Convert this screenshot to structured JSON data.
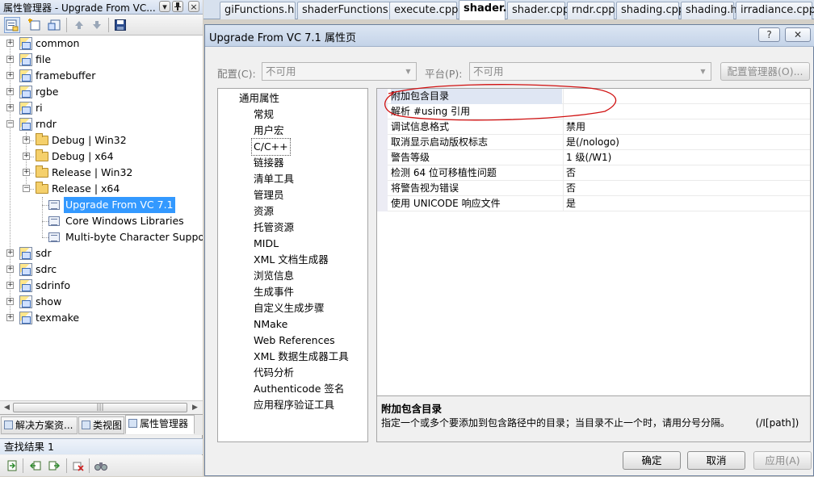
{
  "left_panel": {
    "title": "属性管理器 - Upgrade From VC...",
    "pin_icon": "pin-icon",
    "close_label": "×",
    "dropdown_label": "▾",
    "tree": [
      {
        "label": "common",
        "type": "project"
      },
      {
        "label": "file",
        "type": "project"
      },
      {
        "label": "framebuffer",
        "type": "project"
      },
      {
        "label": "rgbe",
        "type": "project"
      },
      {
        "label": "ri",
        "type": "project"
      },
      {
        "label": "rndr",
        "type": "project"
      },
      {
        "label": "Debug | Win32",
        "type": "folder"
      },
      {
        "label": "Debug | x64",
        "type": "folder"
      },
      {
        "label": "Release | Win32",
        "type": "folder"
      },
      {
        "label": "Release | x64",
        "type": "folder"
      },
      {
        "label": "Upgrade From VC 7.1",
        "type": "sheet"
      },
      {
        "label": "Core Windows Libraries",
        "type": "sheet"
      },
      {
        "label": "Multi-byte Character Support",
        "type": "sheet"
      },
      {
        "label": "sdr",
        "type": "project"
      },
      {
        "label": "sdrc",
        "type": "project"
      },
      {
        "label": "sdrinfo",
        "type": "project"
      },
      {
        "label": "show",
        "type": "project"
      },
      {
        "label": "texmake",
        "type": "project"
      }
    ],
    "scroll_grip": "|||",
    "bottom_tabs": [
      "解决方案资...",
      "类视图",
      "属性管理器"
    ],
    "find_title": "查找结果 1"
  },
  "editor_tabs": [
    "giFunctions.h",
    "shaderFunctions.h",
    "execute.cpp*",
    "shader.h",
    "shader.cpp",
    "rndr.cpp",
    "shading.cpp",
    "shading.h",
    "irradiance.cpp"
  ],
  "dialog": {
    "title": "Upgrade From VC 7.1 属性页",
    "help_label": "?",
    "close_label": "✕",
    "config_label": "配置(C):",
    "config_value": "不可用",
    "platform_label": "平台(P):",
    "platform_value": "不可用",
    "config_manager_button": "配置管理器(O)...",
    "nav_items": [
      "通用属性",
      "常规",
      "用户宏",
      "C/C++",
      "链接器",
      "清单工具",
      "管理员",
      "资源",
      "托管资源",
      "MIDL",
      "XML 文档生成器",
      "浏览信息",
      "生成事件",
      "自定义生成步骤",
      "NMake",
      "Web References",
      "XML 数据生成器工具",
      "代码分析",
      "Authenticode 签名",
      "应用程序验证工具"
    ],
    "properties": [
      {
        "name": "附加包含目录",
        "value": ""
      },
      {
        "name": "解析 #using 引用",
        "value": ""
      },
      {
        "name": "调试信息格式",
        "value": "禁用"
      },
      {
        "name": "取消显示启动版权标志",
        "value": "是(/nologo)"
      },
      {
        "name": "警告等级",
        "value": "1 级(/W1)"
      },
      {
        "name": "检测 64 位可移植性问题",
        "value": "否"
      },
      {
        "name": "将警告视为错误",
        "value": "否"
      },
      {
        "name": "使用 UNICODE 响应文件",
        "value": "是"
      }
    ],
    "description_title": "附加包含目录",
    "description_text": "指定一个或多个要添加到包含路径中的目录；当目录不止一个时，请用分号分隔。",
    "description_switch": "(/I[path])",
    "ok_button": "确定",
    "cancel_button": "取消",
    "apply_button": "应用(A)",
    "annotation_color": "#d01010"
  }
}
